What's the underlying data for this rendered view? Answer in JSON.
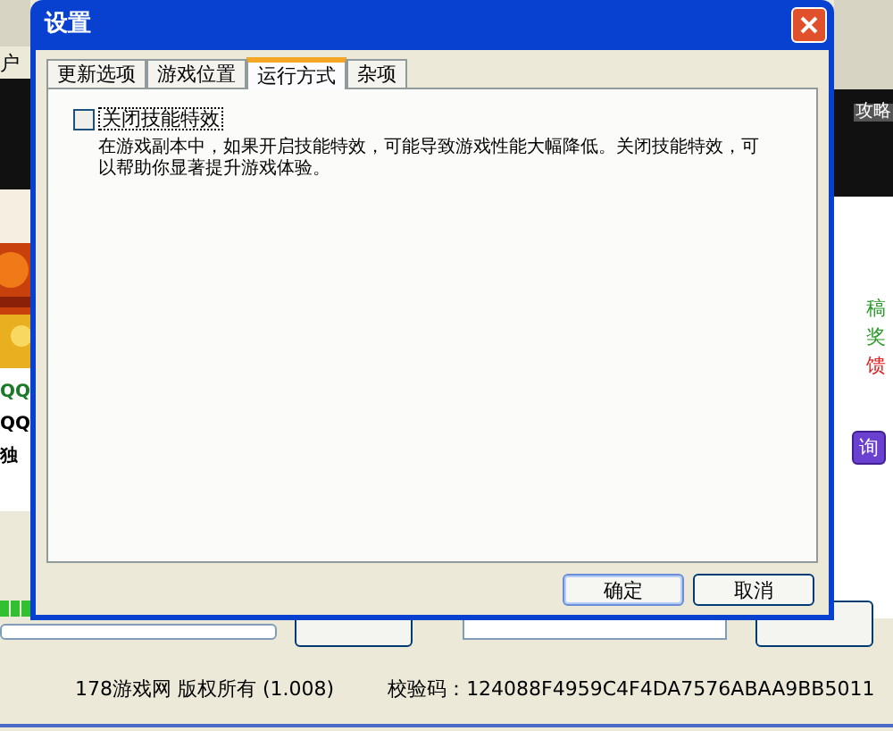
{
  "background_app": {
    "left_texts": [
      {
        "text": "户",
        "color": "#000000"
      },
      {
        "text": "QQ",
        "color": "#1a7a2a"
      },
      {
        "text": "QQ",
        "color": "#000000"
      },
      {
        "text": "独",
        "color": "#000000"
      }
    ],
    "guide_label": "攻略",
    "right_texts": [
      {
        "text": "稿",
        "color": "#2a9a2a"
      },
      {
        "text": "奖",
        "color": "#2a9a2a"
      },
      {
        "text": "馈",
        "color": "#e02020"
      }
    ],
    "query_button": "询",
    "footer": {
      "copyright": "178游戏网 版权所有 (1.008)",
      "checksum_label": "校验码：",
      "checksum": "124088F4959C4F4DA7576ABAA9BB5011"
    }
  },
  "dialog": {
    "title": "设置",
    "tabs": [
      {
        "label": "更新选项",
        "selected": false
      },
      {
        "label": "游戏位置",
        "selected": false
      },
      {
        "label": "运行方式",
        "selected": true
      },
      {
        "label": "杂项",
        "selected": false
      }
    ],
    "option": {
      "label": "关闭技能特效",
      "checked": false,
      "description": "在游戏副本中，如果开启技能特效，可能导致游戏性能大幅降低。关闭技能特效，可以帮助你显著提升游戏体验。"
    },
    "buttons": [
      "确定",
      "取消"
    ]
  }
}
